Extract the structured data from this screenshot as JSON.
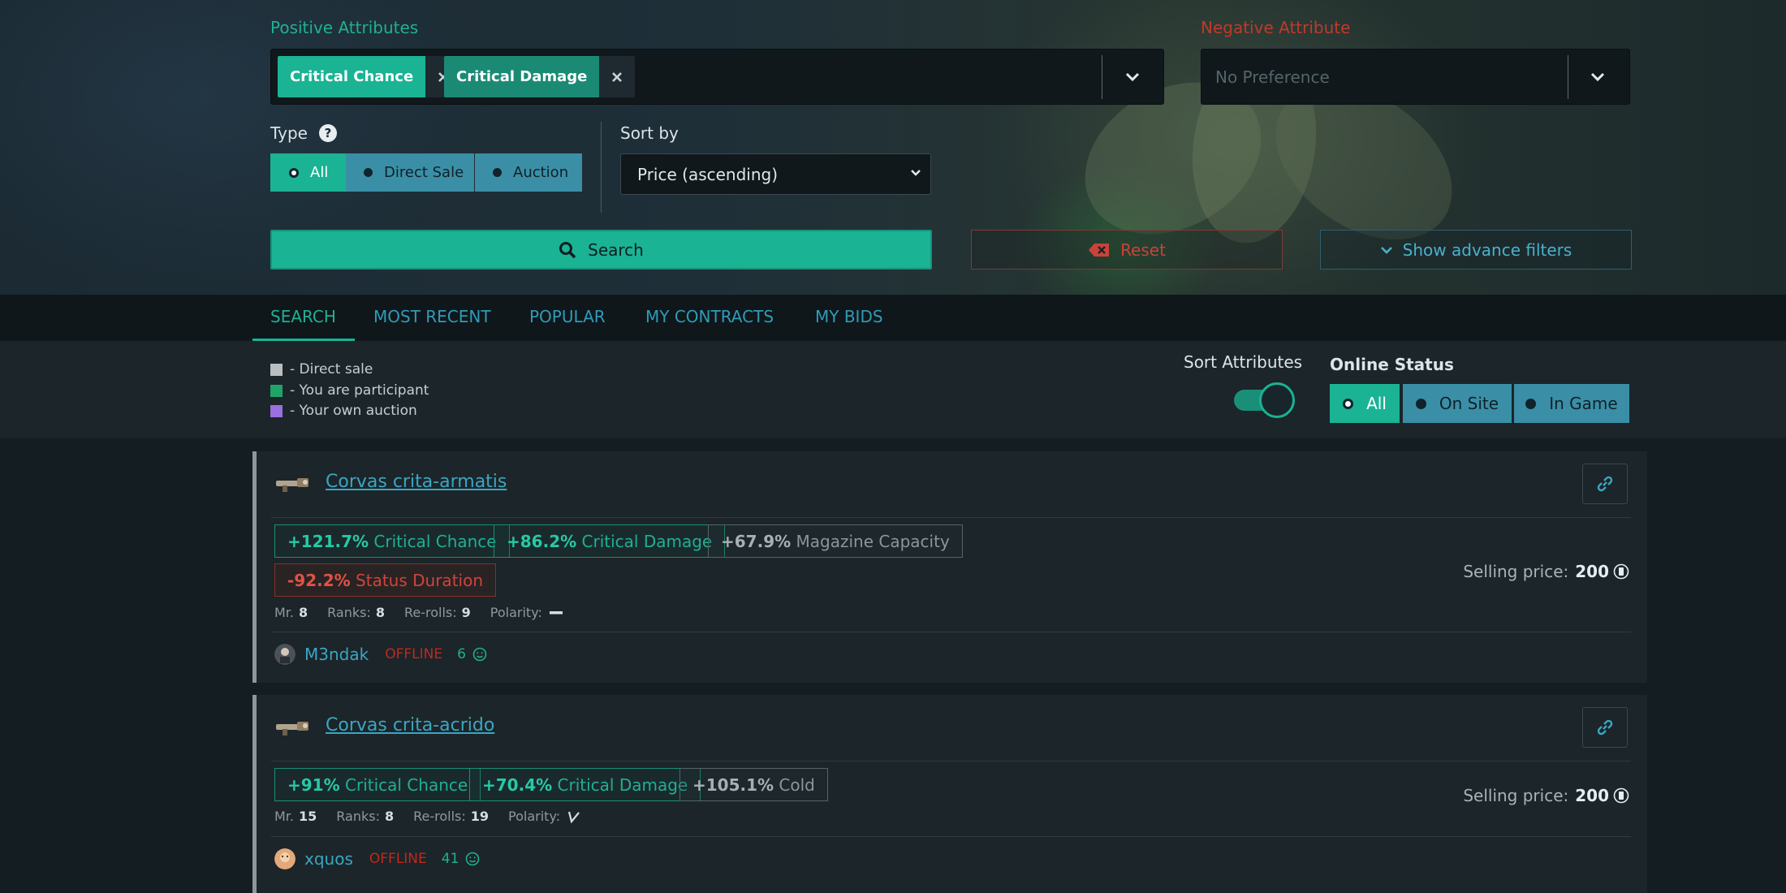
{
  "filters": {
    "positive_label": "Positive Attributes",
    "positive_chips": [
      "Critical Chance",
      "Critical Damage"
    ],
    "negative_label": "Negative Attribute",
    "negative_placeholder": "No Preference",
    "type_label": "Type",
    "type_options": [
      "All",
      "Direct Sale",
      "Auction"
    ],
    "type_selected": "All",
    "sort_label": "Sort by",
    "sort_value": "Price (ascending)",
    "search_label": "Search",
    "reset_label": "Reset",
    "advanced_label": "Show advance filters"
  },
  "tabs": [
    "SEARCH",
    "MOST RECENT",
    "POPULAR",
    "MY CONTRACTS",
    "MY BIDS"
  ],
  "active_tab": "SEARCH",
  "legend": [
    {
      "label": "- Direct sale",
      "color": "#b9bfc1"
    },
    {
      "label": "- You are participant",
      "color": "#1fa46a"
    },
    {
      "label": "- Your own auction",
      "color": "#9a6fe0"
    }
  ],
  "sort_attributes": {
    "label": "Sort Attributes",
    "enabled": true
  },
  "online_status": {
    "label": "Online Status",
    "options": [
      "All",
      "On Site",
      "In Game"
    ],
    "selected": "All"
  },
  "listings": [
    {
      "title": "Corvas crita-armatis",
      "attributes": [
        {
          "value": "+121.7%",
          "name": "Critical Chance",
          "kind": "pos"
        },
        {
          "value": "+86.2%",
          "name": "Critical Damage",
          "kind": "pos"
        },
        {
          "value": "+67.9%",
          "name": "Magazine Capacity",
          "kind": "neu"
        },
        {
          "value": "-92.2%",
          "name": "Status Duration",
          "kind": "neg"
        }
      ],
      "meta": {
        "mr_label": "Mr.",
        "mr": "8",
        "ranks_label": "Ranks:",
        "ranks": "8",
        "rerolls_label": "Re-rolls:",
        "rerolls": "9",
        "polarity_label": "Polarity:",
        "polarity_icon": "naramon-polarity-icon"
      },
      "user": {
        "name": "M3ndak",
        "status": "OFFLINE",
        "reputation": "6"
      },
      "price_label": "Selling price:",
      "price": "200",
      "price_icon": "platinum-icon"
    },
    {
      "title": "Corvas crita-acrido",
      "attributes": [
        {
          "value": "+91%",
          "name": "Critical Chance",
          "kind": "pos"
        },
        {
          "value": "+70.4%",
          "name": "Critical Damage",
          "kind": "pos"
        },
        {
          "value": "+105.1%",
          "name": "Cold",
          "kind": "neu"
        }
      ],
      "meta": {
        "mr_label": "Mr.",
        "mr": "15",
        "ranks_label": "Ranks:",
        "ranks": "8",
        "rerolls_label": "Re-rolls:",
        "rerolls": "19",
        "polarity_label": "Polarity:",
        "polarity_icon": "madurai-polarity-icon"
      },
      "user": {
        "name": "xquos",
        "status": "OFFLINE",
        "reputation": "41"
      },
      "price_label": "Selling price:",
      "price": "200",
      "price_icon": "platinum-icon"
    }
  ],
  "colors": {
    "accent": "#1ab394",
    "link": "#3aa6c4",
    "danger": "#c9433a",
    "secondary": "#3a8fa6"
  }
}
